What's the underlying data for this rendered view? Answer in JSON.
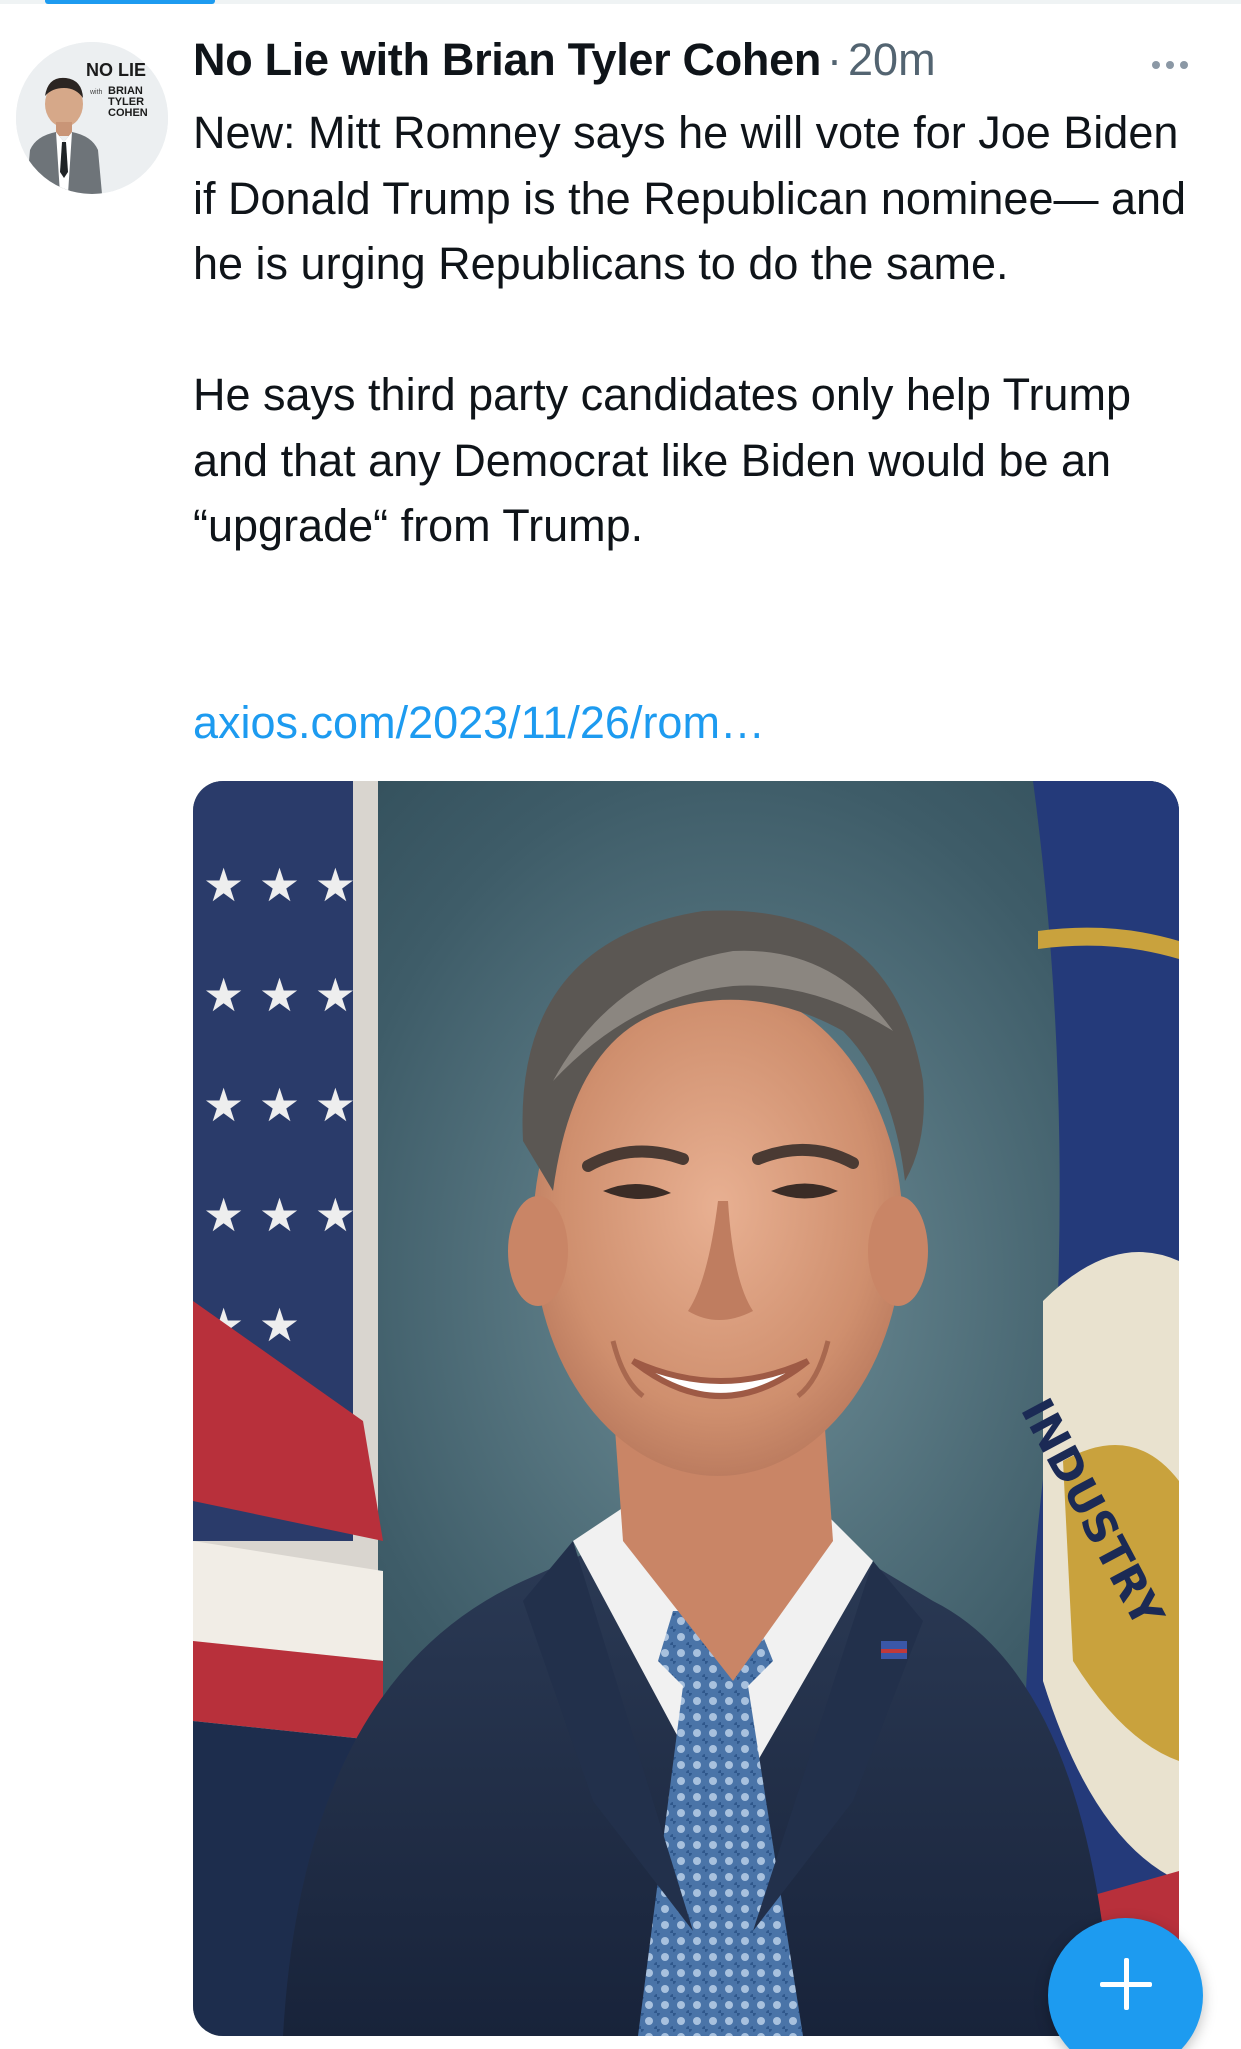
{
  "tweet": {
    "author": {
      "display_name": "No Lie with Brian Tyler Cohen",
      "avatar_brand": "NO LIE",
      "avatar_sub_small": "with",
      "avatar_sub_1": "BRIAN",
      "avatar_sub_2": "TYLER",
      "avatar_sub_3": "COHEN"
    },
    "separator": "·",
    "timestamp": "20m",
    "paragraph_1": "New: Mitt Romney says he will vote for Joe Biden if Donald Trump is the Republican nominee— and he is urging Republicans to do the same.",
    "paragraph_2": "He says third party candidates only help Trump and that any Democrat like Biden would be an “upgrade“ from Trump.",
    "link_text": "axios.com/2023/11/26/rom…",
    "media": {
      "flag_text": "INDUSTRY"
    }
  },
  "colors": {
    "accent": "#1d9bf0",
    "text_primary": "#0f1419",
    "text_secondary": "#536471"
  },
  "icons": {
    "more": "more-horizontal-icon",
    "compose": "plus-icon"
  }
}
